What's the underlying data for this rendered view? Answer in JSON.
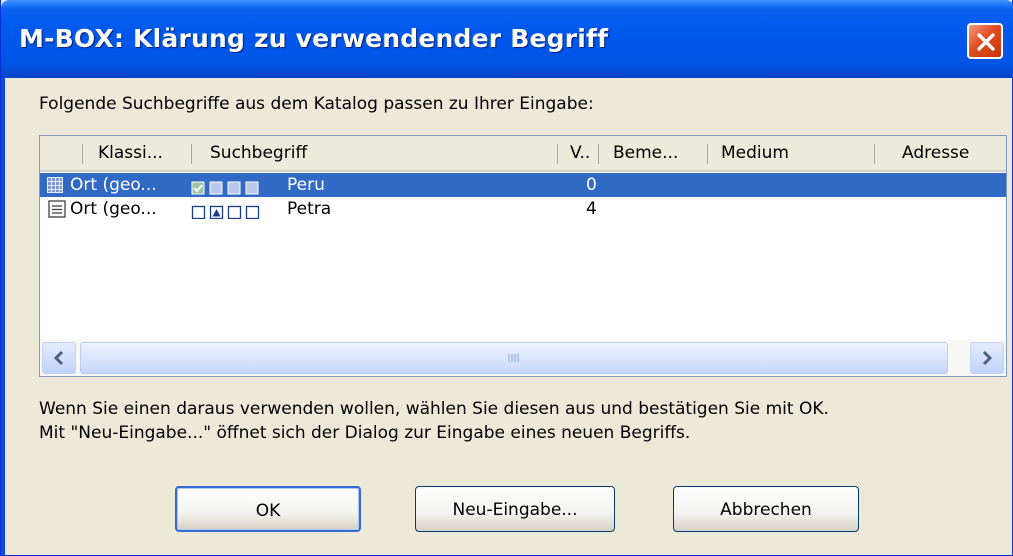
{
  "window": {
    "title": "M-BOX: Klärung zu verwendender Begriff",
    "close_icon": "close-icon",
    "accent": "#0055e5",
    "close_color": "#e24e20"
  },
  "intro": "Folgende Suchbegriffe aus dem Katalog passen zu Ihrer Eingabe:",
  "list": {
    "columns": [
      "Klassi...",
      "Suchbegriff",
      "V..",
      "Beme...",
      "Medium",
      "Adresse"
    ],
    "rows": [
      {
        "icon": "grid-icon",
        "klassi": "Ort (geo...",
        "term": "Peru",
        "v": "0",
        "selected": true
      },
      {
        "icon": "document-icon",
        "klassi": "Ort (geo...",
        "term": "Petra",
        "v": "4",
        "selected": false
      }
    ],
    "selection_color": "#316ac5"
  },
  "info": {
    "line1": "Wenn Sie einen daraus verwenden wollen, wählen Sie diesen aus und bestätigen Sie mit OK.",
    "line2": "Mit \"Neu-Eingabe...\" öffnet sich der Dialog zur Eingabe eines neuen Begriffs."
  },
  "buttons": {
    "ok": "OK",
    "new_entry": "Neu-Eingabe...",
    "cancel": "Abbrechen"
  }
}
